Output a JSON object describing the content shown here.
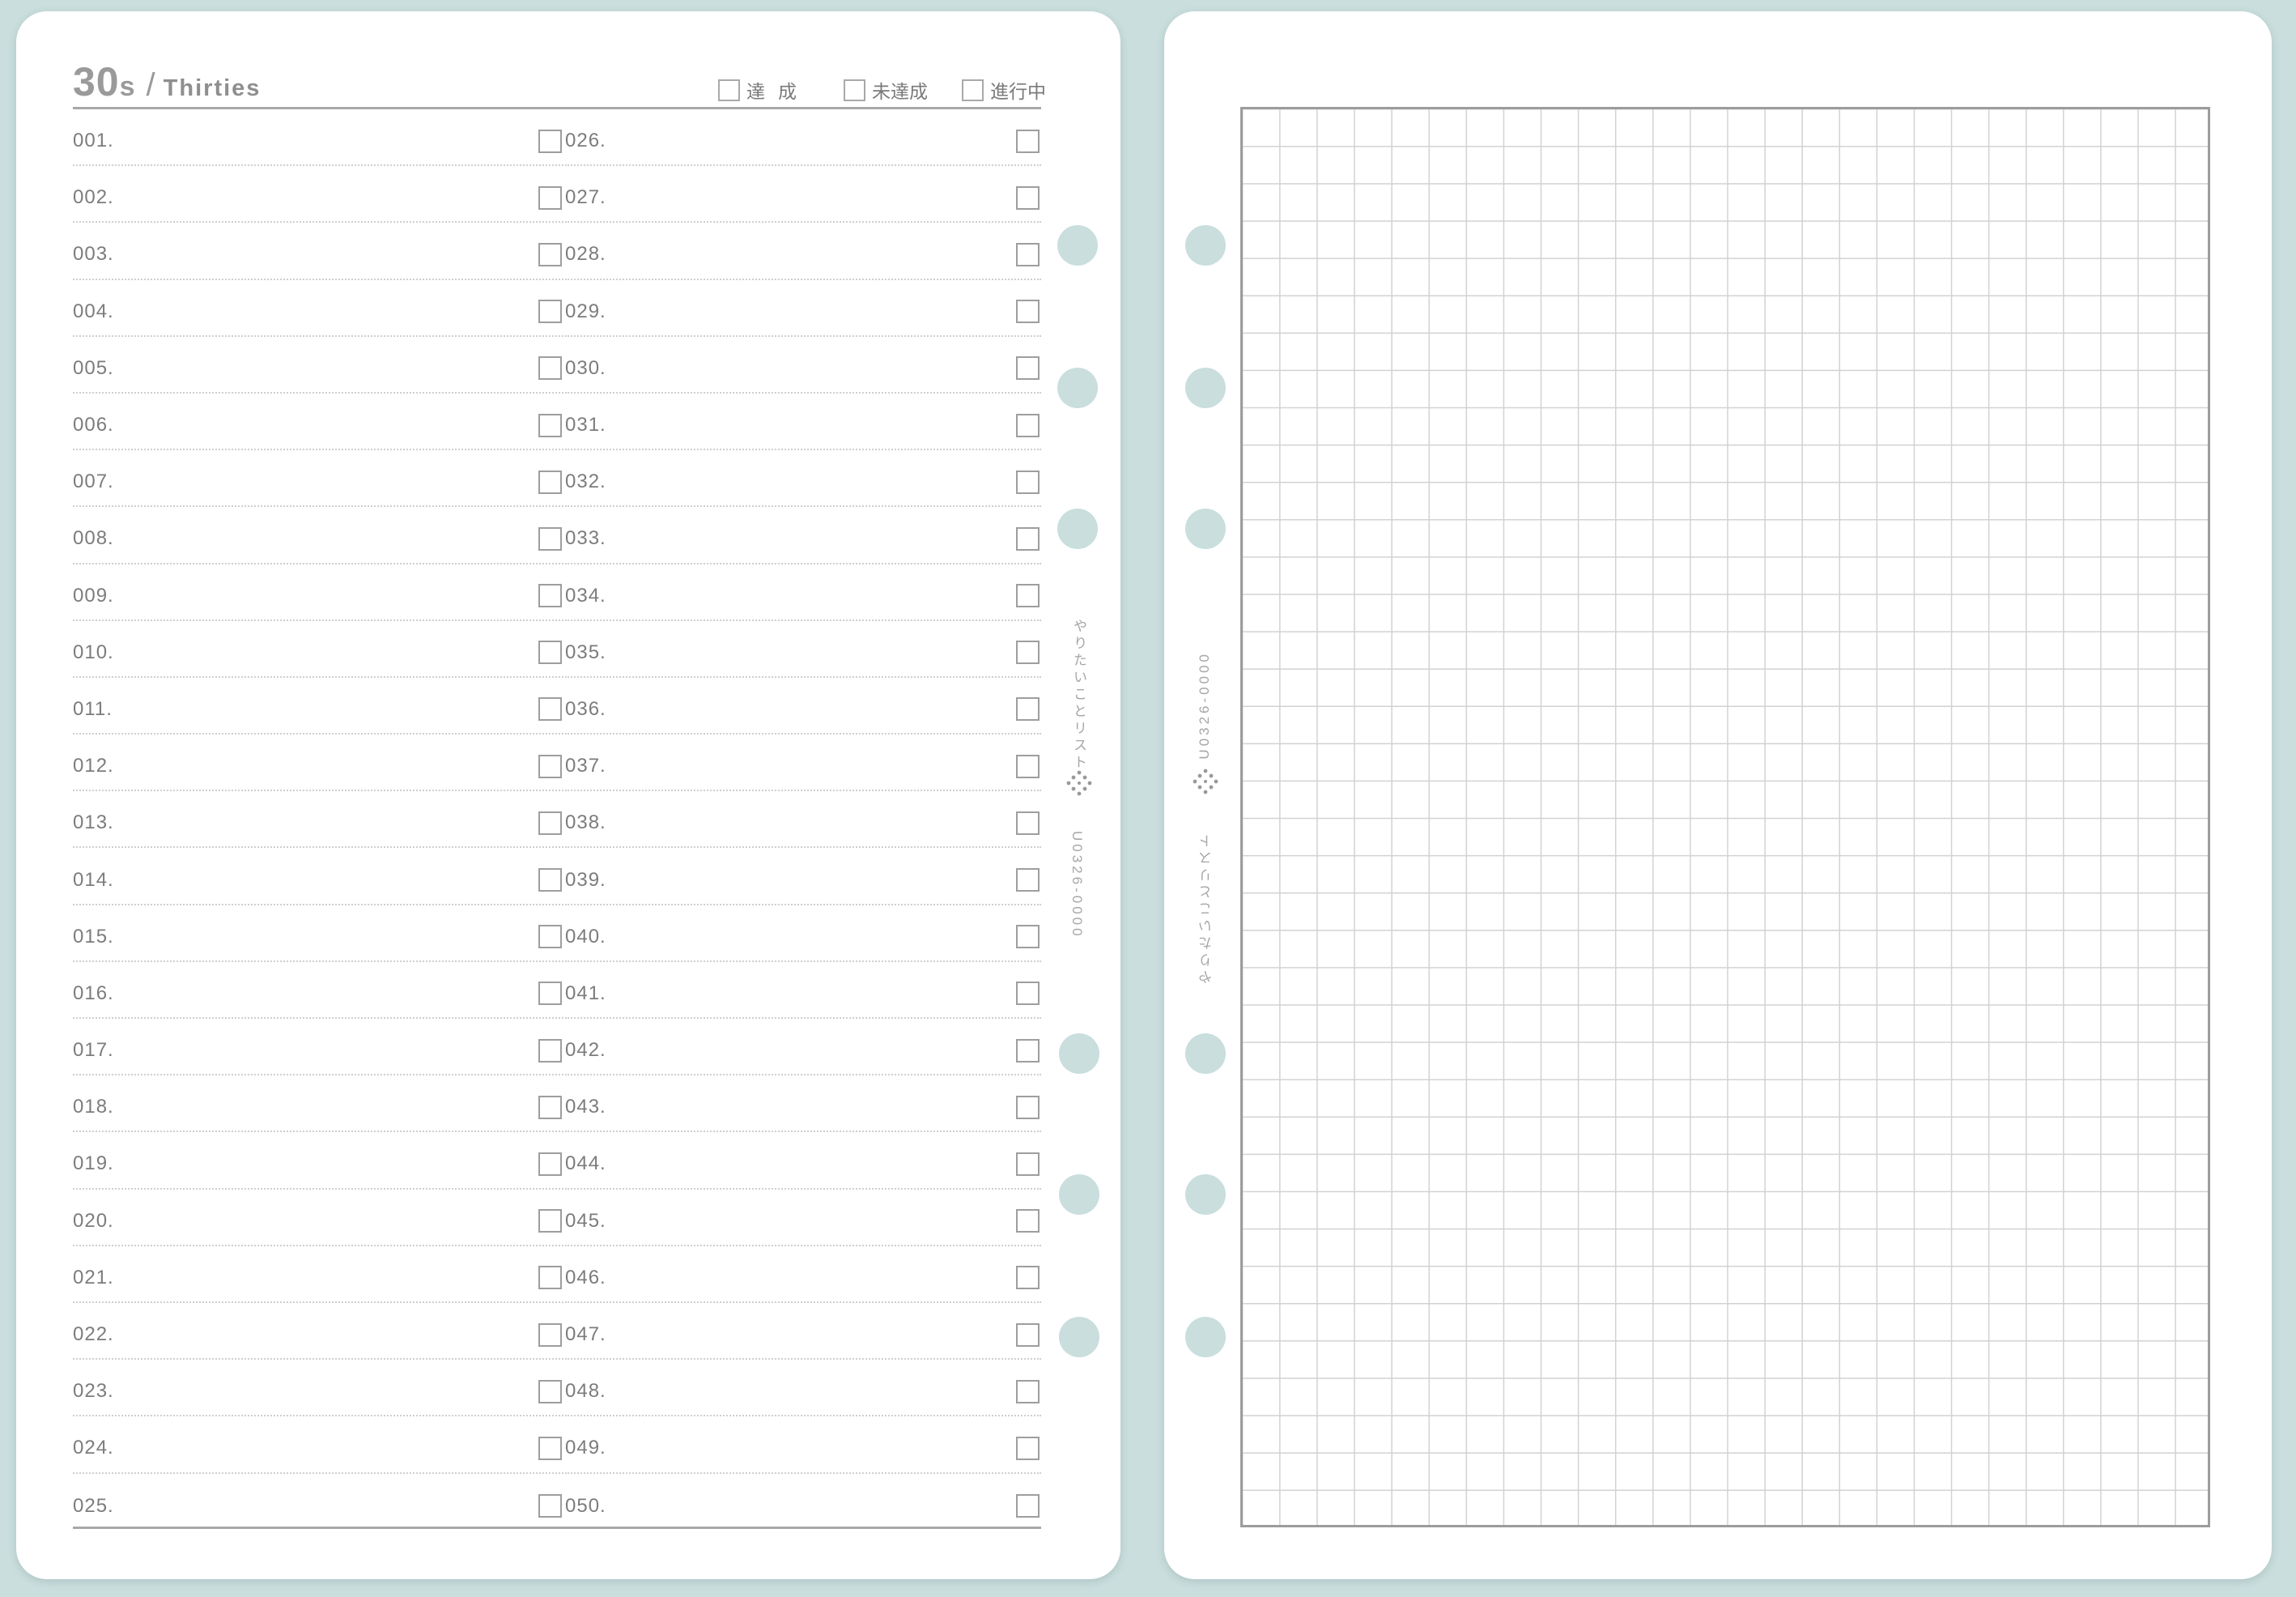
{
  "left_page": {
    "title_number": "30",
    "title_suffix": "s",
    "title_slash": "/",
    "title_english": "Thirties",
    "legend": [
      {
        "label": "達成"
      },
      {
        "label": "未達成"
      },
      {
        "label": "進行中"
      }
    ],
    "items_col_a": [
      "001.",
      "002.",
      "003.",
      "004.",
      "005.",
      "006.",
      "007.",
      "008.",
      "009.",
      "010.",
      "011.",
      "012.",
      "013.",
      "014.",
      "015.",
      "016.",
      "017.",
      "018.",
      "019.",
      "020.",
      "021.",
      "022.",
      "023.",
      "024.",
      "025."
    ],
    "items_col_b": [
      "026.",
      "027.",
      "028.",
      "029.",
      "030.",
      "031.",
      "032.",
      "033.",
      "034.",
      "035.",
      "036.",
      "037.",
      "038.",
      "039.",
      "040.",
      "041.",
      "042.",
      "043.",
      "044.",
      "045.",
      "046.",
      "047.",
      "048.",
      "049.",
      "050."
    ],
    "spine_title": "やりたいことリスト",
    "spine_code": "U0326-0000"
  },
  "right_page": {
    "spine_title": "やりたいことリスト",
    "spine_code": "U0326-0000"
  },
  "colors": {
    "background": "#c9dedd",
    "paper": "#ffffff",
    "ink": "#7c7c7c",
    "grid_line": "#d2d2d2"
  }
}
